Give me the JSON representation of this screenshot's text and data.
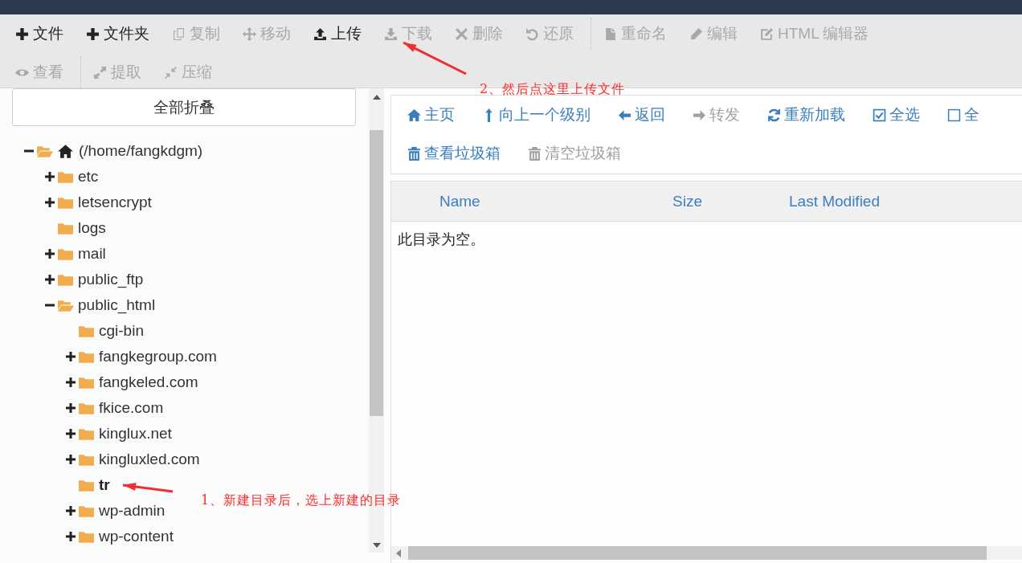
{
  "toolbar": {
    "rows": [
      {
        "groups": [
          {
            "items": [
              {
                "label": "文件",
                "disabled": false
              },
              {
                "label": "文件夹",
                "disabled": false
              },
              {
                "label": "复制",
                "disabled": true
              },
              {
                "label": "移动",
                "disabled": true
              },
              {
                "label": "上传",
                "disabled": false
              },
              {
                "label": "下载",
                "disabled": true
              },
              {
                "label": "删除",
                "disabled": true
              },
              {
                "label": "还原",
                "disabled": true
              }
            ]
          },
          {
            "items": [
              {
                "label": "重命名",
                "disabled": true
              },
              {
                "label": "编辑",
                "disabled": true
              },
              {
                "label": "HTML 编辑器",
                "disabled": true
              }
            ]
          }
        ]
      },
      {
        "groups": [
          {
            "items": [
              {
                "label": "查看",
                "disabled": true
              }
            ]
          },
          {
            "items": [
              {
                "label": "提取",
                "disabled": true
              },
              {
                "label": "压缩",
                "disabled": true
              }
            ]
          }
        ]
      }
    ]
  },
  "tree_panel": {
    "collapse_button": "全部折叠",
    "tree": [
      {
        "kind": "home",
        "label": "(/home/fangkdgm)",
        "expandable": true,
        "expanded": true,
        "selected": false,
        "children": [
          {
            "kind": "folder",
            "label": "etc",
            "expandable": true,
            "expanded": false,
            "selected": false
          },
          {
            "kind": "folder",
            "label": "letsencrypt",
            "expandable": true,
            "expanded": false,
            "selected": false
          },
          {
            "kind": "folder",
            "label": "logs",
            "expandable": false,
            "expanded": false,
            "selected": false
          },
          {
            "kind": "folder",
            "label": "mail",
            "expandable": true,
            "expanded": false,
            "selected": false
          },
          {
            "kind": "folder",
            "label": "public_ftp",
            "expandable": true,
            "expanded": false,
            "selected": false
          },
          {
            "kind": "folder",
            "label": "public_html",
            "expandable": true,
            "expanded": true,
            "selected": false,
            "children": [
              {
                "kind": "folder",
                "label": "cgi-bin",
                "expandable": false,
                "expanded": false,
                "selected": false
              },
              {
                "kind": "folder",
                "label": "fangkegroup.com",
                "expandable": true,
                "expanded": false,
                "selected": false
              },
              {
                "kind": "folder",
                "label": "fangkeled.com",
                "expandable": true,
                "expanded": false,
                "selected": false
              },
              {
                "kind": "folder",
                "label": "fkice.com",
                "expandable": true,
                "expanded": false,
                "selected": false
              },
              {
                "kind": "folder",
                "label": "kinglux.net",
                "expandable": true,
                "expanded": false,
                "selected": false
              },
              {
                "kind": "folder",
                "label": "kingluxled.com",
                "expandable": true,
                "expanded": false,
                "selected": false
              },
              {
                "kind": "folder",
                "label": "tr",
                "expandable": false,
                "expanded": false,
                "selected": true
              },
              {
                "kind": "folder",
                "label": "wp-admin",
                "expandable": true,
                "expanded": false,
                "selected": false
              },
              {
                "kind": "folder",
                "label": "wp-content",
                "expandable": true,
                "expanded": false,
                "selected": false
              }
            ]
          }
        ]
      }
    ]
  },
  "nav": {
    "rows": [
      {
        "items": [
          {
            "label": "主页",
            "disabled": false
          },
          {
            "label": "向上一个级别",
            "disabled": false
          },
          {
            "label": "返回",
            "disabled": false
          },
          {
            "label": "转发",
            "disabled": true
          },
          {
            "label": "重新加载",
            "disabled": false
          },
          {
            "label": "全选",
            "disabled": false
          },
          {
            "label": "全",
            "disabled": false
          }
        ]
      },
      {
        "items": [
          {
            "label": "查看垃圾箱",
            "disabled": false
          },
          {
            "label": "清空垃圾箱",
            "disabled": true
          }
        ]
      }
    ]
  },
  "table": {
    "columns": [
      "Name",
      "Size",
      "Last Modified"
    ],
    "empty_message": "此目录为空。"
  },
  "annotations": [
    {
      "text": "2、然后点这里上传文件"
    },
    {
      "text": "1、新建目录后，选上新建的目录"
    }
  ]
}
